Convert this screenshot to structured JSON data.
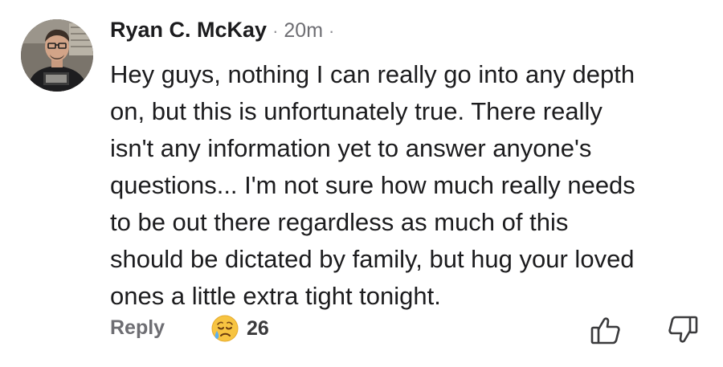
{
  "comment": {
    "author_name": "Ryan C. McKay",
    "separator": "·",
    "timestamp": "20m",
    "separator_trailing": "·",
    "text": "Hey guys, nothing I can really go into any depth\non, but this is unfortunately true. There really\nisn't any information yet to answer anyone's\nquestions... I'm not sure how much really needs\nto be out there regardless as much of this\nshould be dictated by family, but hug your loved\nones a little extra tight tonight.",
    "avatar_icon": "person-photo"
  },
  "actions": {
    "reply_label": "Reply",
    "reaction_icon": "sad-tear-emoji",
    "reaction_count": "26",
    "like_icon": "thumbs-up-icon",
    "dislike_icon": "thumbs-down-icon"
  },
  "colors": {
    "text_primary": "#1c1c1e",
    "text_secondary": "#6e6e73",
    "emoji_face": "#f7c441",
    "emoji_tear": "#5ab0f2"
  }
}
